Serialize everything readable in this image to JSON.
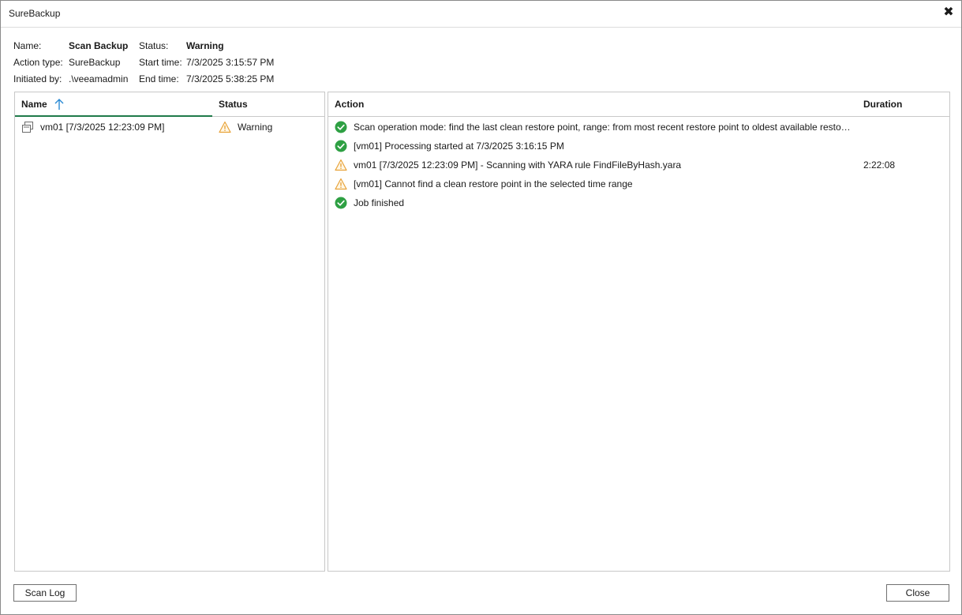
{
  "window": {
    "title": "SureBackup",
    "close_glyph": "✖"
  },
  "summary": {
    "name_label": "Name:",
    "name_value": "Scan Backup",
    "status_label": "Status:",
    "status_value": "Warning",
    "action_type_label": "Action type:",
    "action_type_value": "SureBackup",
    "start_time_label": "Start time:",
    "start_time_value": "7/3/2025 3:15:57 PM",
    "initiated_by_label": "Initiated by:",
    "initiated_by_value": ".\\veeamadmin",
    "end_time_label": "End time:",
    "end_time_value": "7/3/2025 5:38:25 PM"
  },
  "objects_grid": {
    "columns": {
      "name": "Name",
      "status": "Status"
    },
    "rows": [
      {
        "name": "vm01 [7/3/2025 12:23:09 PM]",
        "status": "Warning",
        "name_icon": "vm-icon",
        "status_icon": "warning-icon"
      }
    ]
  },
  "actions_grid": {
    "columns": {
      "action": "Action",
      "duration": "Duration"
    },
    "rows": [
      {
        "icon": "success-icon",
        "action": "Scan operation mode: find the last clean restore point, range: from most recent restore point to oldest available restor...",
        "duration": ""
      },
      {
        "icon": "success-icon",
        "action": "[vm01] Processing started at 7/3/2025 3:16:15 PM",
        "duration": ""
      },
      {
        "icon": "warning-icon",
        "action": "vm01 [7/3/2025 12:23:09 PM] - Scanning with YARA rule FindFileByHash.yara",
        "duration": "2:22:08"
      },
      {
        "icon": "warning-icon",
        "action": "[vm01] Cannot find a clean restore point in the selected time range",
        "duration": ""
      },
      {
        "icon": "success-icon",
        "action": "Job finished",
        "duration": ""
      }
    ]
  },
  "buttons": {
    "scan_log": "Scan Log",
    "close": "Close"
  },
  "colors": {
    "success": "#2ea043",
    "warning": "#e8a33a",
    "sort_indicator": "#1f7a4a",
    "sort_arrow": "#2a8ad4"
  }
}
